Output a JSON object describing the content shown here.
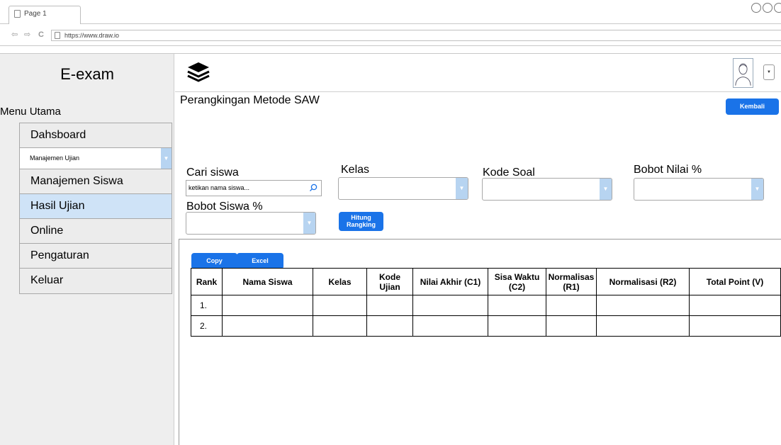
{
  "browser": {
    "tab_label": "Page 1",
    "url": "https://www.draw.io",
    "nav_back": "⇦",
    "nav_forward": "⇨",
    "nav_reload": "C"
  },
  "sidebar": {
    "brand": "E-exam",
    "menu_title": "Menu Utama",
    "items": [
      {
        "label": "Dahsboard"
      },
      {
        "label": "Manajemen Ujian"
      },
      {
        "label": "Manajemen Siswa"
      },
      {
        "label": "Hasil Ujian"
      },
      {
        "label": "Online"
      },
      {
        "label": "Pengaturan"
      },
      {
        "label": "Keluar"
      }
    ],
    "active_item": "Hasil Ujian"
  },
  "header": {
    "logo_icon": "layers-icon",
    "avatar_icon": "user-avatar-icon",
    "dropdown_icon": "caret-down-icon"
  },
  "main": {
    "title": "Perangkingan Metode SAW",
    "back_button": "Kembali",
    "search_label": "Cari siswa",
    "search_placeholder": "ketikan nama siswa...",
    "kelas_label": "Kelas",
    "kode_soal_label": "Kode Soal",
    "bobot_nilai_label": "Bobot Nilai %",
    "bobot_siswa_label": "Bobot Siswa %",
    "hitung_line1": "Hitung",
    "hitung_line2": "Rangking",
    "copy_button": "Copy",
    "excel_button": "Excel"
  },
  "table": {
    "headers": [
      {
        "l1": "Rank",
        "l2": ""
      },
      {
        "l1": "Nama Siswa",
        "l2": ""
      },
      {
        "l1": "Kelas",
        "l2": ""
      },
      {
        "l1": "Kode",
        "l2": "Ujian"
      },
      {
        "l1": "Nilai Akhir (C1)",
        "l2": ""
      },
      {
        "l1": "Sisa Waktu",
        "l2": "(C2)"
      },
      {
        "l1": "Normalisas",
        "l2": "(R1)"
      },
      {
        "l1": "Normalisasi (R2)",
        "l2": ""
      },
      {
        "l1": "Total Point (V)",
        "l2": ""
      }
    ],
    "rows": [
      {
        "rank": "1."
      },
      {
        "rank": "2."
      }
    ]
  },
  "colors": {
    "accent": "#1a73e8",
    "active_menu": "#cfe3f7",
    "select_arrow": "#b7d4f1",
    "sidebar_bg": "#eeeeee"
  }
}
